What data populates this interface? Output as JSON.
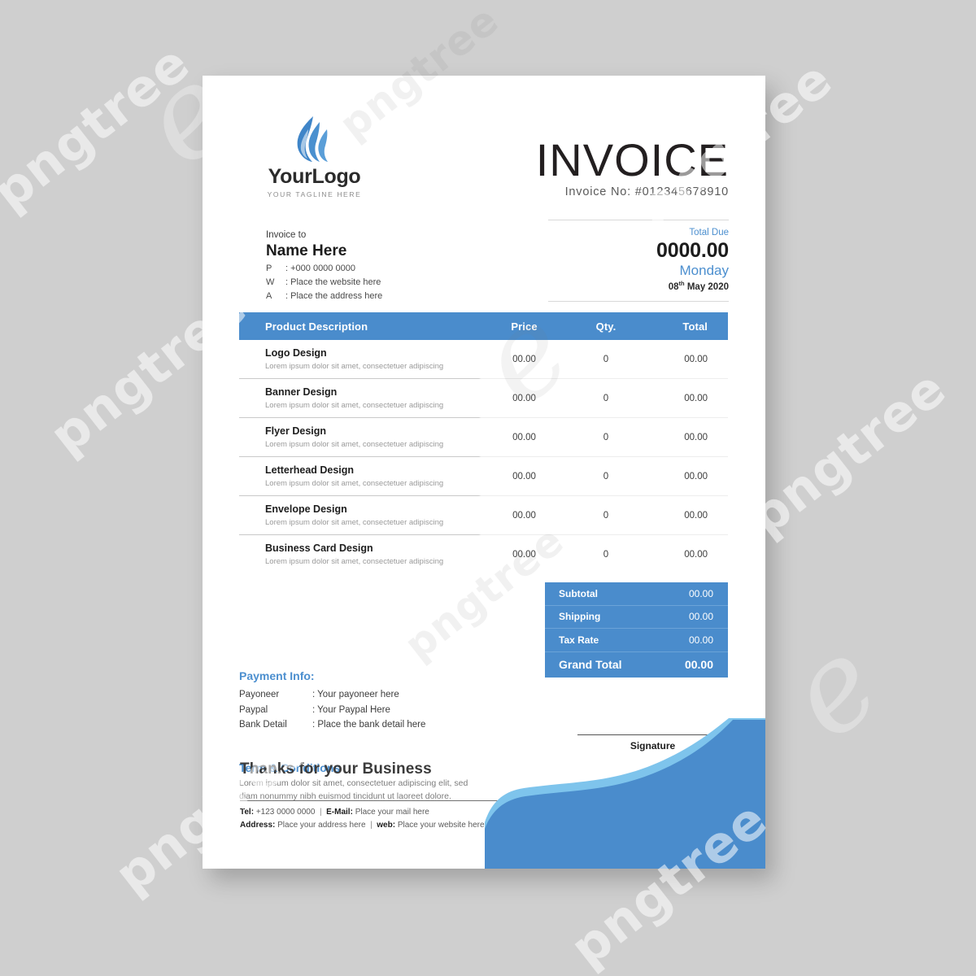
{
  "colors": {
    "accent_blue": "#4a8ccc",
    "accent_blue_light": "#7ec4ec",
    "text_blue": "#4c8fcf",
    "page_background": "#cfcfcf"
  },
  "watermark": {
    "text": "pngtree",
    "mark": "e"
  },
  "header": {
    "logo_name": "YourLogo",
    "logo_tagline": "YOUR TAGLINE HERE",
    "logo_icon": "flame-icon",
    "title": "INVOICE",
    "invoice_number_label": "Invoice No: #012345678910"
  },
  "bill_to": {
    "label": "Invoice to",
    "name": "Name Here",
    "lines": [
      {
        "key": "P",
        "value": ": +000 0000 0000"
      },
      {
        "key": "W",
        "value": ": Place the website here"
      },
      {
        "key": "A",
        "value": ": Place the address here"
      }
    ]
  },
  "total_due": {
    "label": "Total Due",
    "amount": "0000.00",
    "day": "Monday",
    "date_number": "08",
    "date_suffix": "th",
    "date_rest": "May 2020"
  },
  "items_table": {
    "columns": {
      "description": "Product Description",
      "price": "Price",
      "qty": "Qty.",
      "total": "Total"
    },
    "rows": [
      {
        "name": "Logo Design",
        "sub": "Lorem ipsum dolor sit amet, consectetuer adipiscing",
        "price": "00.00",
        "qty": "0",
        "total": "00.00"
      },
      {
        "name": "Banner Design",
        "sub": "Lorem ipsum dolor sit amet, consectetuer adipiscing",
        "price": "00.00",
        "qty": "0",
        "total": "00.00"
      },
      {
        "name": "Flyer Design",
        "sub": "Lorem ipsum dolor sit amet, consectetuer adipiscing",
        "price": "00.00",
        "qty": "0",
        "total": "00.00"
      },
      {
        "name": "Letterhead Design",
        "sub": "Lorem ipsum dolor sit amet, consectetuer adipiscing",
        "price": "00.00",
        "qty": "0",
        "total": "00.00"
      },
      {
        "name": "Envelope Design",
        "sub": "Lorem ipsum dolor sit amet, consectetuer adipiscing",
        "price": "00.00",
        "qty": "0",
        "total": "00.00"
      },
      {
        "name": "Business Card Design",
        "sub": "Lorem ipsum dolor sit amet, consectetuer adipiscing",
        "price": "00.00",
        "qty": "0",
        "total": "00.00"
      }
    ]
  },
  "payment_info": {
    "title": "Payment Info:",
    "lines": [
      {
        "key": "Payoneer",
        "value": ": Your payoneer here"
      },
      {
        "key": "Paypal",
        "value": ": Your Paypal Here"
      },
      {
        "key": "Bank Detail",
        "value": ": Place the bank detail here"
      }
    ]
  },
  "totals": {
    "rows": [
      {
        "label": "Subtotal",
        "value": "00.00"
      },
      {
        "label": "Shipping",
        "value": "00.00"
      },
      {
        "label": "Tax Rate",
        "value": "00.00"
      }
    ],
    "grand": {
      "label": "Grand Total",
      "value": "00.00"
    }
  },
  "terms": {
    "title": "Term & Conditions",
    "line1": "Lorem ipsum dolor sit amet, consectetuer adipiscing elit, sed",
    "line2": "diam nonummy nibh euismod tincidunt ut laoreet dolore."
  },
  "signature": {
    "label": "Signature"
  },
  "thanks": {
    "text": "Thanks for your Business"
  },
  "footer": {
    "tel_label": "Tel:",
    "tel_value": "+123 0000 0000",
    "email_label": "E-Mail:",
    "email_value": "Place your mail here",
    "address_label": "Address:",
    "address_value": "Place your address here",
    "web_label": "web:",
    "web_value": "Place your website here",
    "separator": "|"
  }
}
